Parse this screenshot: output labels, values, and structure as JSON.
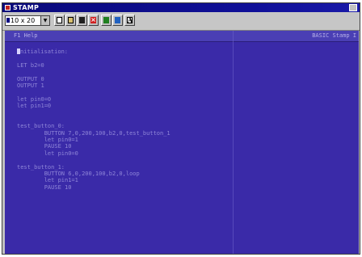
{
  "window": {
    "title": "STAMP"
  },
  "toolbar": {
    "font_size_value": "10 x 20",
    "buttons": [
      {
        "name": "new-file-button",
        "icon": "new-file-icon"
      },
      {
        "name": "open-file-button",
        "icon": "open-folder-icon"
      },
      {
        "name": "save-file-button",
        "icon": "save-icon"
      },
      {
        "name": "close-file-button",
        "icon": "close-icon"
      },
      {
        "name": "run-button",
        "icon": "run-icon"
      },
      {
        "name": "identify-button",
        "icon": "identify-icon"
      },
      {
        "name": "font-button",
        "icon": "font-icon",
        "label": "A"
      }
    ]
  },
  "editor": {
    "help_label": "F1 Help",
    "mode_label": "BASIC Stamp I",
    "background_color": "#3a2aa8",
    "text_color": "#8f86d8",
    "lines": [
      "Initialisation:",
      "",
      "LET b2=0",
      "",
      "OUTPUT 0",
      "OUTPUT 1",
      "",
      "let pin0=0",
      "let pin1=0",
      "",
      "",
      "test_button_0:",
      "        BUTTON 7,0,200,100,b2,0,test_button_1",
      "        let pin0=1",
      "        PAUSE 10",
      "        let pin0=0",
      "",
      "test_button_1:",
      "        BUTTON 6,0,200,100,b2,0,loop",
      "        let pin1=1",
      "        PAUSE 10"
    ]
  }
}
